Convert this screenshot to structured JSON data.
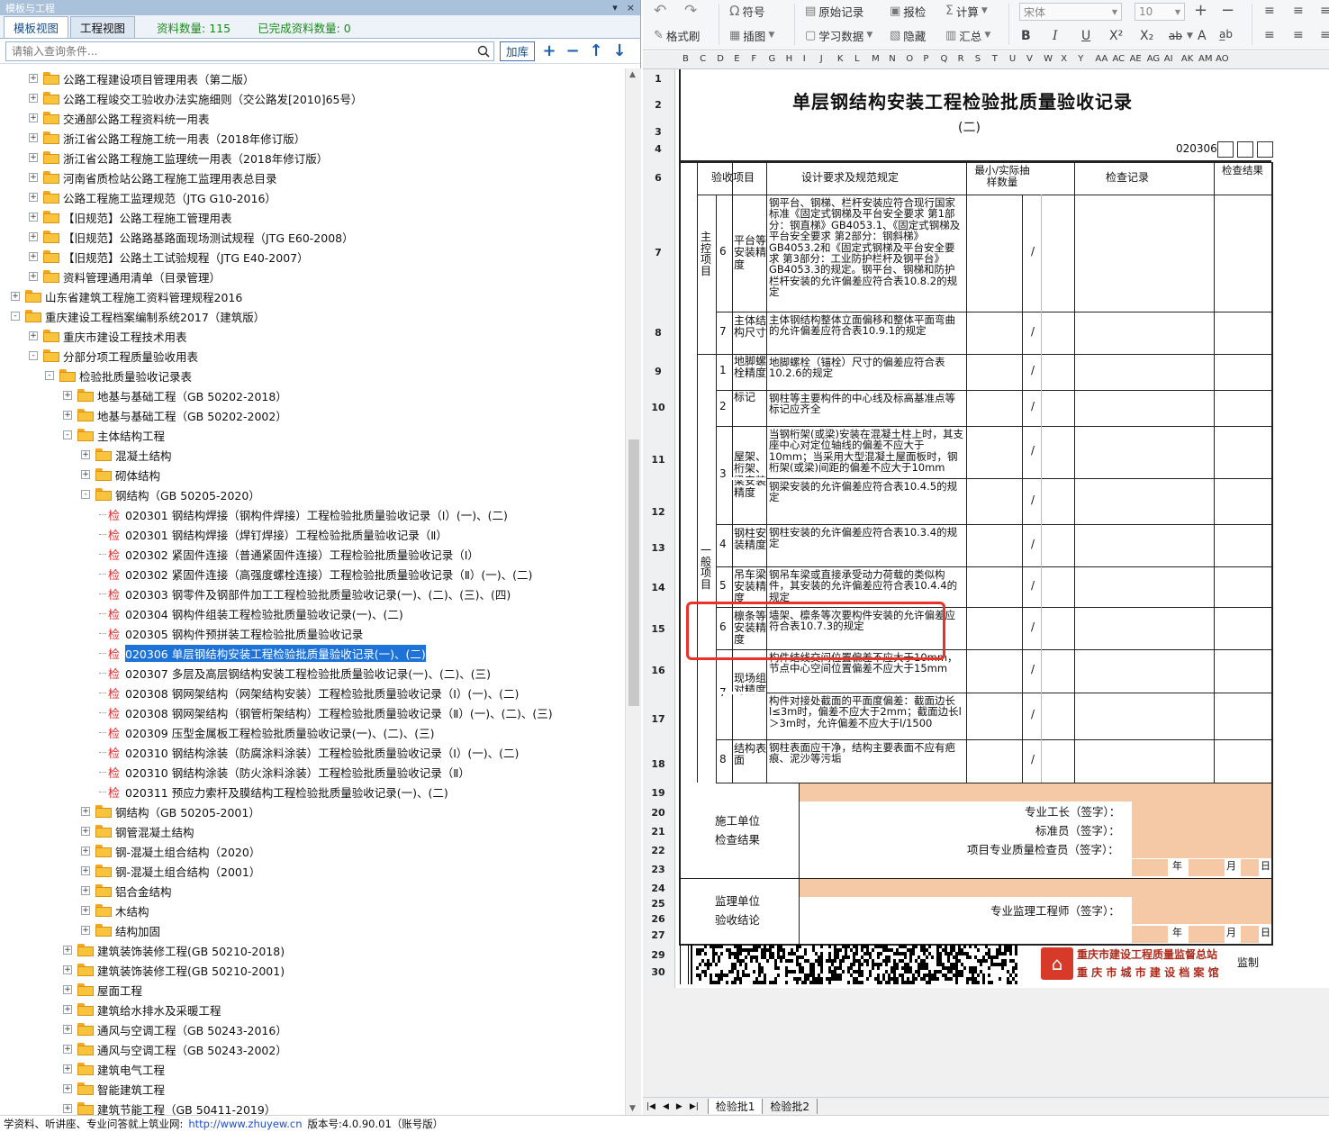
{
  "left_panel": {
    "title": "模板与工程",
    "tabs": [
      {
        "label": "模板视图",
        "active": true
      },
      {
        "label": "工程视图",
        "active": false
      }
    ],
    "stat_count": "资料数量: 115",
    "stat_done": "已完成资料数量: 0",
    "search_placeholder": "请输入查询条件...",
    "add_lib_label": "加库",
    "tree": [
      {
        "text": "公路工程建设项目管理用表（第二版）",
        "level": 2,
        "type": "folder",
        "exp": "+"
      },
      {
        "text": "公路工程竣交工验收办法实施细则（交公路发[2010]65号）",
        "level": 2,
        "type": "folder",
        "exp": "+"
      },
      {
        "text": "交通部公路工程资料统一用表",
        "level": 2,
        "type": "folder",
        "exp": "+"
      },
      {
        "text": "浙江省公路工程施工统一用表（2018年修订版）",
        "level": 2,
        "type": "folder",
        "exp": "+"
      },
      {
        "text": "浙江省公路工程施工监理统一用表（2018年修订版）",
        "level": 2,
        "type": "folder",
        "exp": "+"
      },
      {
        "text": "河南省质检站公路工程施工监理用表总目录",
        "level": 2,
        "type": "folder",
        "exp": "+"
      },
      {
        "text": "公路工程施工监理规范（JTG G10-2016）",
        "level": 2,
        "type": "folder",
        "exp": "+"
      },
      {
        "text": "【旧规范】公路工程施工管理用表",
        "level": 2,
        "type": "folder",
        "exp": "+"
      },
      {
        "text": "【旧规范】公路路基路面现场测试规程（JTG E60-2008）",
        "level": 2,
        "type": "folder",
        "exp": "+"
      },
      {
        "text": "【旧规范】公路土工试验规程（JTG E40-2007）",
        "level": 2,
        "type": "folder",
        "exp": "+"
      },
      {
        "text": "资料管理通用清单（目录管理）",
        "level": 2,
        "type": "folder",
        "exp": "+"
      },
      {
        "text": "山东省建筑工程施工资料管理规程2016",
        "level": 1,
        "type": "folder",
        "exp": "+"
      },
      {
        "text": "重庆建设工程档案编制系统2017（建筑版）",
        "level": 1,
        "type": "folder",
        "exp": "-"
      },
      {
        "text": "重庆市建设工程技术用表",
        "level": 2,
        "type": "folder",
        "exp": "+"
      },
      {
        "text": "分部分项工程质量验收用表",
        "level": 2,
        "type": "folder",
        "exp": "-"
      },
      {
        "text": "检验批质量验收记录表",
        "level": 3,
        "type": "folder",
        "exp": "-"
      },
      {
        "text": "地基与基础工程（GB 50202-2018）",
        "level": 4,
        "type": "folder",
        "exp": "+"
      },
      {
        "text": "地基与基础工程（GB 50202-2002）",
        "level": 4,
        "type": "folder",
        "exp": "+"
      },
      {
        "text": "主体结构工程",
        "level": 4,
        "type": "folder",
        "exp": "-"
      },
      {
        "text": "混凝土结构",
        "level": 5,
        "type": "folder",
        "exp": "+"
      },
      {
        "text": "砌体结构",
        "level": 5,
        "type": "folder",
        "exp": "+"
      },
      {
        "text": "钢结构（GB 50205-2020）",
        "level": 5,
        "type": "folder",
        "exp": "-"
      },
      {
        "text": "020301 钢结构焊接（钢构件焊接）工程检验批质量验收记录（Ⅰ）(一)、(二)",
        "level": 6,
        "type": "check"
      },
      {
        "text": "020301 钢结构焊接（焊钉焊接）工程检验批质量验收记录（Ⅱ）",
        "level": 6,
        "type": "check"
      },
      {
        "text": "020302 紧固件连接（普通紧固件连接）工程检验批质量验收记录（Ⅰ）",
        "level": 6,
        "type": "check"
      },
      {
        "text": "020302 紧固件连接（高强度螺栓连接）工程检验批质量验收记录（Ⅱ）(一)、(二)",
        "level": 6,
        "type": "check"
      },
      {
        "text": "020303 钢零件及钢部件加工工程检验批质量验收记录(一)、(二)、(三)、(四)",
        "level": 6,
        "type": "check"
      },
      {
        "text": "020304 钢构件组装工程检验批质量验收记录(一)、(二)",
        "level": 6,
        "type": "check"
      },
      {
        "text": "020305 钢构件预拼装工程检验批质量验收记录",
        "level": 6,
        "type": "check"
      },
      {
        "text": "020306 单层钢结构安装工程检验批质量验收记录(一)、(二)",
        "level": 6,
        "type": "check",
        "selected": true
      },
      {
        "text": "020307 多层及高层钢结构安装工程检验批质量验收记录(一)、(二)、(三)",
        "level": 6,
        "type": "check"
      },
      {
        "text": "020308 钢网架结构（网架结构安装）工程检验批质量验收记录（Ⅰ）(一)、(二)",
        "level": 6,
        "type": "check"
      },
      {
        "text": "020308 钢网架结构（钢管桁架结构）工程检验批质量验收记录（Ⅱ）(一)、(二)、(三)",
        "level": 6,
        "type": "check"
      },
      {
        "text": "020309 压型金属板工程检验批质量验收记录(一)、(二)、(三)",
        "level": 6,
        "type": "check"
      },
      {
        "text": "020310 钢结构涂装（防腐涂料涂装）工程检验批质量验收记录（Ⅰ）(一)、(二)",
        "level": 6,
        "type": "check"
      },
      {
        "text": "020310 钢结构涂装（防火涂料涂装）工程检验批质量验收记录（Ⅱ）",
        "level": 6,
        "type": "check"
      },
      {
        "text": "020311 预应力索杆及膜结构工程检验批质量验收记录(一)、(二)",
        "level": 6,
        "type": "check"
      },
      {
        "text": "钢结构（GB 50205-2001）",
        "level": 5,
        "type": "folder",
        "exp": "+"
      },
      {
        "text": "钢管混凝土结构",
        "level": 5,
        "type": "folder",
        "exp": "+"
      },
      {
        "text": "钢-混凝土组合结构（2020）",
        "level": 5,
        "type": "folder",
        "exp": "+"
      },
      {
        "text": "钢-混凝土组合结构（2001）",
        "level": 5,
        "type": "folder",
        "exp": "+"
      },
      {
        "text": "铝合金结构",
        "level": 5,
        "type": "folder",
        "exp": "+"
      },
      {
        "text": "木结构",
        "level": 5,
        "type": "folder",
        "exp": "+"
      },
      {
        "text": "结构加固",
        "level": 5,
        "type": "folder",
        "exp": "+"
      },
      {
        "text": "建筑装饰装修工程(GB 50210-2018)",
        "level": 4,
        "type": "folder",
        "exp": "+"
      },
      {
        "text": "建筑装饰装修工程(GB 50210-2001)",
        "level": 4,
        "type": "folder",
        "exp": "+"
      },
      {
        "text": "屋面工程",
        "level": 4,
        "type": "folder",
        "exp": "+"
      },
      {
        "text": "建筑给水排水及采暖工程",
        "level": 4,
        "type": "folder",
        "exp": "+"
      },
      {
        "text": "通风与空调工程（GB 50243-2016）",
        "level": 4,
        "type": "folder",
        "exp": "+"
      },
      {
        "text": "通风与空调工程（GB 50243-2002）",
        "level": 4,
        "type": "folder",
        "exp": "+"
      },
      {
        "text": "建筑电气工程",
        "level": 4,
        "type": "folder",
        "exp": "+"
      },
      {
        "text": "智能建筑工程",
        "level": 4,
        "type": "folder",
        "exp": "+"
      },
      {
        "text": "建筑节能工程（GB 50411-2019）",
        "level": 4,
        "type": "folder",
        "exp": "+"
      }
    ]
  },
  "toolbar": {
    "symbol": "符号",
    "original_record": "原始记录",
    "report_check": "报检",
    "calc": "计算",
    "format_painter": "格式刷",
    "insert_image": "插图",
    "study_data": "学习数据",
    "hide": "隐藏",
    "summary": "汇总",
    "font_name": "宋体",
    "font_size": "10"
  },
  "sheet": {
    "col_headers": [
      "B",
      "C",
      "D",
      "E",
      "F",
      "G",
      "H",
      "I",
      "J",
      "K",
      "L",
      "M",
      "N",
      "O",
      "P",
      "Q",
      "R",
      "S",
      "T",
      "U",
      "V",
      "W",
      "X",
      "Y",
      "AA",
      "AC",
      "AE",
      "AG",
      "AI",
      "AK",
      "AM",
      "AO"
    ],
    "row_numbers": [
      "1",
      "2",
      "3",
      "4",
      "6",
      "7",
      "8",
      "9",
      "10",
      "11",
      "12",
      "13",
      "14",
      "15",
      "16",
      "17",
      "18",
      "19",
      "20",
      "21",
      "22",
      "23",
      "24",
      "25",
      "26",
      "27",
      "29",
      "30"
    ],
    "title": "单层钢结构安装工程检验批质量验收记录",
    "subtitle": "(二)",
    "code": "020306",
    "headers": {
      "item": "验收项目",
      "design": "设计要求及规范规定",
      "sample": "最小/实际抽样数量",
      "record": "检查记录",
      "result": "检查结果"
    },
    "main_control": "主控项目",
    "general": "一般项目",
    "slash": "/",
    "rows": [
      {
        "num": "6",
        "name": "平台等安装精度",
        "desc": "钢平台、钢梯、栏杆安装应符合现行国家标准《固定式钢梯及平台安全要求 第1部分：钢直梯》GB4053.1、《固定式钢梯及平台安全要求 第2部分：钢斜梯》GB4053.2和《固定式钢梯及平台安全要求 第3部分：工业防护栏杆及钢平台》GB4053.3的规定。钢平台、钢梯和防护栏杆安装的允许偏差应符合表10.8.2的规定"
      },
      {
        "num": "7",
        "name": "主体结构尺寸",
        "desc": "主体钢结构整体立面偏移和整体平面弯曲的允许偏差应符合表10.9.1的规定"
      },
      {
        "num": "1",
        "name": "地脚螺栓精度",
        "desc": "地脚螺栓（锚栓）尺寸的偏差应符合表10.2.6的规定"
      },
      {
        "num": "2",
        "name": "标记",
        "desc": "钢柱等主要构件的中心线及标高基准点等标记应齐全"
      },
      {
        "num": "3",
        "name": "屋架、桁架、梁安装精度",
        "desc": "当钢桁架(或梁)安装在混凝土柱上时，其支座中心对定位轴线的偏差不应大于10mm；当采用大型混凝土屋面板时，钢桁架(或梁)间距的偏差不应大于10mm"
      },
      {
        "num": "",
        "name": "",
        "desc": "钢梁安装的允许偏差应符合表10.4.5的规定"
      },
      {
        "num": "4",
        "name": "钢柱安装精度",
        "desc": "钢柱安装的允许偏差应符合表10.3.4的规定"
      },
      {
        "num": "5",
        "name": "吊车梁安装精度",
        "desc": "钢吊车梁或直接承受动力荷载的类似构件，其安装的允许偏差应符合表10.4.4的规定"
      },
      {
        "num": "6",
        "name": "檩条等安装精度",
        "desc": "墙架、檩条等次要构件安装的允许偏差应符合表10.7.3的规定"
      },
      {
        "num": "7",
        "name": "现场组对精度",
        "desc": "构件结线交间位置偏差不应大于10mm，节点中心空间位置偏差不应大于15mm"
      },
      {
        "num": "",
        "name": "",
        "desc": "构件对接处截面的平面度偏差：截面边长l≤3m时，偏差不应大于2mm；截面边长l＞3m时，允许偏差不应大于l/1500"
      },
      {
        "num": "8",
        "name": "结构表面",
        "desc": "钢柱表面应干净，结构主要表面不应有疤痕、泥沙等污垢"
      }
    ],
    "construction_unit": "施工单位检查结果",
    "foreman": "专业工长（签字）：",
    "standard_officer": "标准员（签字）：",
    "quality_inspector": "项目专业质量检查员（签字）：",
    "supervision_unit": "监理单位验收结论",
    "supervisor": "专业监理工程师（签字）：",
    "year": "年",
    "month": "月",
    "day": "日",
    "footer_org1": "重庆市建设工程质量监督总站",
    "footer_org2": "重 庆 市 城 市 建 设 档 案 馆",
    "footer_monitor": "监制",
    "sheet_tabs": [
      "检验批1",
      "检验批2"
    ]
  },
  "status": {
    "text": "学资料、听讲座、专业问答就上筑业网:",
    "url": "http://www.zhuyew.cn",
    "version": "版本号:4.0.90.01（账号版）"
  }
}
